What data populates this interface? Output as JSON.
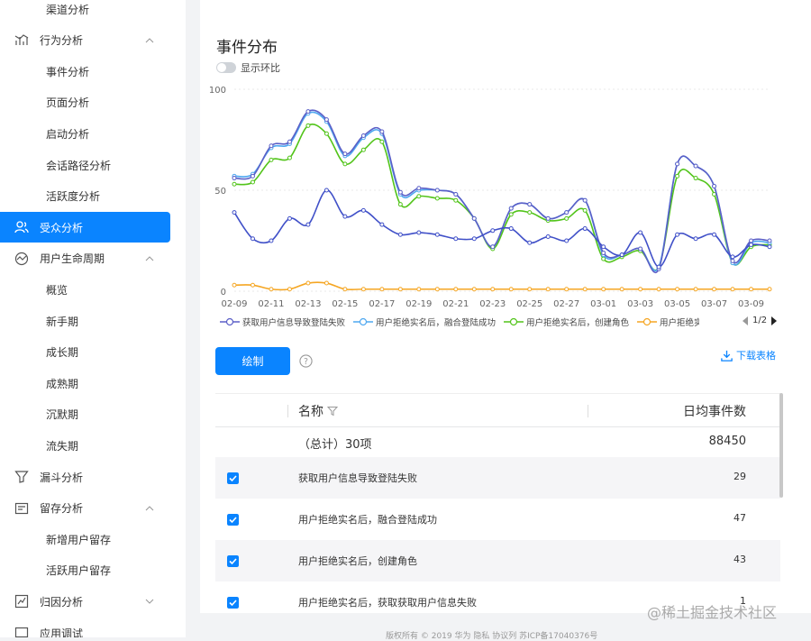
{
  "sidebar": {
    "items": [
      {
        "label": "渠道分析",
        "type": "child"
      },
      {
        "label": "行为分析",
        "type": "parent",
        "icon": "behavior-chart-icon",
        "chevron": "up"
      },
      {
        "label": "事件分析",
        "type": "child"
      },
      {
        "label": "页面分析",
        "type": "child"
      },
      {
        "label": "启动分析",
        "type": "child"
      },
      {
        "label": "会话路径分析",
        "type": "child"
      },
      {
        "label": "活跃度分析",
        "type": "child"
      },
      {
        "label": "受众分析",
        "type": "parent",
        "icon": "users-icon",
        "active": true
      },
      {
        "label": "用户生命周期",
        "type": "parent",
        "icon": "lifecycle-icon",
        "chevron": "up"
      },
      {
        "label": "概览",
        "type": "child"
      },
      {
        "label": "新手期",
        "type": "child"
      },
      {
        "label": "成长期",
        "type": "child"
      },
      {
        "label": "成熟期",
        "type": "child"
      },
      {
        "label": "沉默期",
        "type": "child"
      },
      {
        "label": "流失期",
        "type": "child"
      },
      {
        "label": "漏斗分析",
        "type": "parent",
        "icon": "funnel-icon"
      },
      {
        "label": "留存分析",
        "type": "parent",
        "icon": "retention-icon",
        "chevron": "up"
      },
      {
        "label": "新增用户留存",
        "type": "child"
      },
      {
        "label": "活跃用户留存",
        "type": "child"
      },
      {
        "label": "归因分析",
        "type": "parent",
        "icon": "attribution-icon",
        "chevron": "down"
      },
      {
        "label": "应用调试",
        "type": "parent",
        "icon": "debug-icon"
      }
    ]
  },
  "main": {
    "title": "事件分布",
    "toggle_label": "显示环比",
    "draw_button": "绘制",
    "download_label": "下载表格",
    "pager": "1/2"
  },
  "chart_data": {
    "type": "line",
    "ylim": [
      0,
      100
    ],
    "yticks": [
      "0",
      "50",
      "100"
    ],
    "x": [
      "02-09",
      "02-10",
      "02-11",
      "02-12",
      "02-13",
      "02-14",
      "02-15",
      "02-16",
      "02-17",
      "02-18",
      "02-19",
      "02-20",
      "02-21",
      "02-22",
      "02-23",
      "02-24",
      "02-25",
      "02-26",
      "02-27",
      "02-28",
      "03-01",
      "03-02",
      "03-03",
      "03-04",
      "03-05",
      "03-06",
      "03-07",
      "03-08",
      "03-09",
      "03-10"
    ],
    "xtick_labels": [
      "02-09",
      "02-11",
      "02-13",
      "02-15",
      "02-17",
      "02-19",
      "02-21",
      "02-23",
      "02-25",
      "02-27",
      "03-01",
      "03-03",
      "03-05",
      "03-07",
      "03-09"
    ],
    "series": [
      {
        "name": "获取用户信息导致登陆失败",
        "color": "#5b5fc7",
        "values": [
          56,
          57,
          72,
          74,
          89,
          85,
          68,
          77,
          79,
          49,
          51,
          50,
          48,
          36,
          22,
          41,
          43,
          36,
          39,
          45,
          19,
          18,
          21,
          11,
          63,
          62,
          52,
          15,
          25,
          25
        ]
      },
      {
        "name": "用户拒绝实名后，融合登陆成功",
        "color": "#4fa8f0",
        "values": [
          57,
          58,
          71,
          73,
          88,
          84,
          67,
          76,
          78,
          48,
          50,
          50,
          48,
          36,
          22,
          41,
          43,
          36,
          39,
          45,
          18,
          18,
          21,
          12,
          63,
          62,
          52,
          14,
          24,
          24
        ]
      },
      {
        "name": "用户拒绝实名后，创建角色",
        "color": "#52c41a",
        "values": [
          53,
          54,
          65,
          66,
          82,
          78,
          63,
          70,
          74,
          43,
          47,
          46,
          45,
          36,
          21,
          38,
          39,
          35,
          36,
          40,
          16,
          17,
          20,
          12,
          57,
          56,
          48,
          14,
          22,
          23
        ]
      },
      {
        "name": "用户拒绝实名后，获取获取用户信息失败",
        "color": "#f5a623",
        "values": [
          3,
          3,
          1,
          1,
          4,
          4,
          1,
          1,
          1,
          1,
          1,
          1,
          1,
          1,
          1,
          1,
          1,
          1,
          1,
          1,
          1,
          1,
          1,
          1,
          1,
          1,
          1,
          1,
          1,
          1
        ]
      },
      {
        "name": "",
        "color": "#4050c8",
        "values": [
          39,
          26,
          25,
          36,
          33,
          50,
          37,
          40,
          33,
          28,
          29,
          28,
          26,
          26,
          30,
          31,
          24,
          27,
          25,
          31,
          22,
          18,
          29,
          12,
          28,
          26,
          28,
          17,
          23,
          22
        ]
      }
    ],
    "legend_position": "bottom"
  },
  "table": {
    "headers": [
      "名称",
      "日均事件数"
    ],
    "total": {
      "name": "（总计）30项",
      "value": "88450"
    },
    "rows": [
      {
        "name": "获取用户信息导致登陆失败",
        "value": "29"
      },
      {
        "name": "用户拒绝实名后，融合登陆成功",
        "value": "47"
      },
      {
        "name": "用户拒绝实名后，创建角色",
        "value": "43"
      },
      {
        "name": "用户拒绝实名后，获取获取用户信息失败",
        "value": "1"
      }
    ]
  },
  "footer": "版权所有 © 2019 华为   隐私   协议列   苏ICP备17040376号",
  "watermark": "@稀土掘金技术社区"
}
